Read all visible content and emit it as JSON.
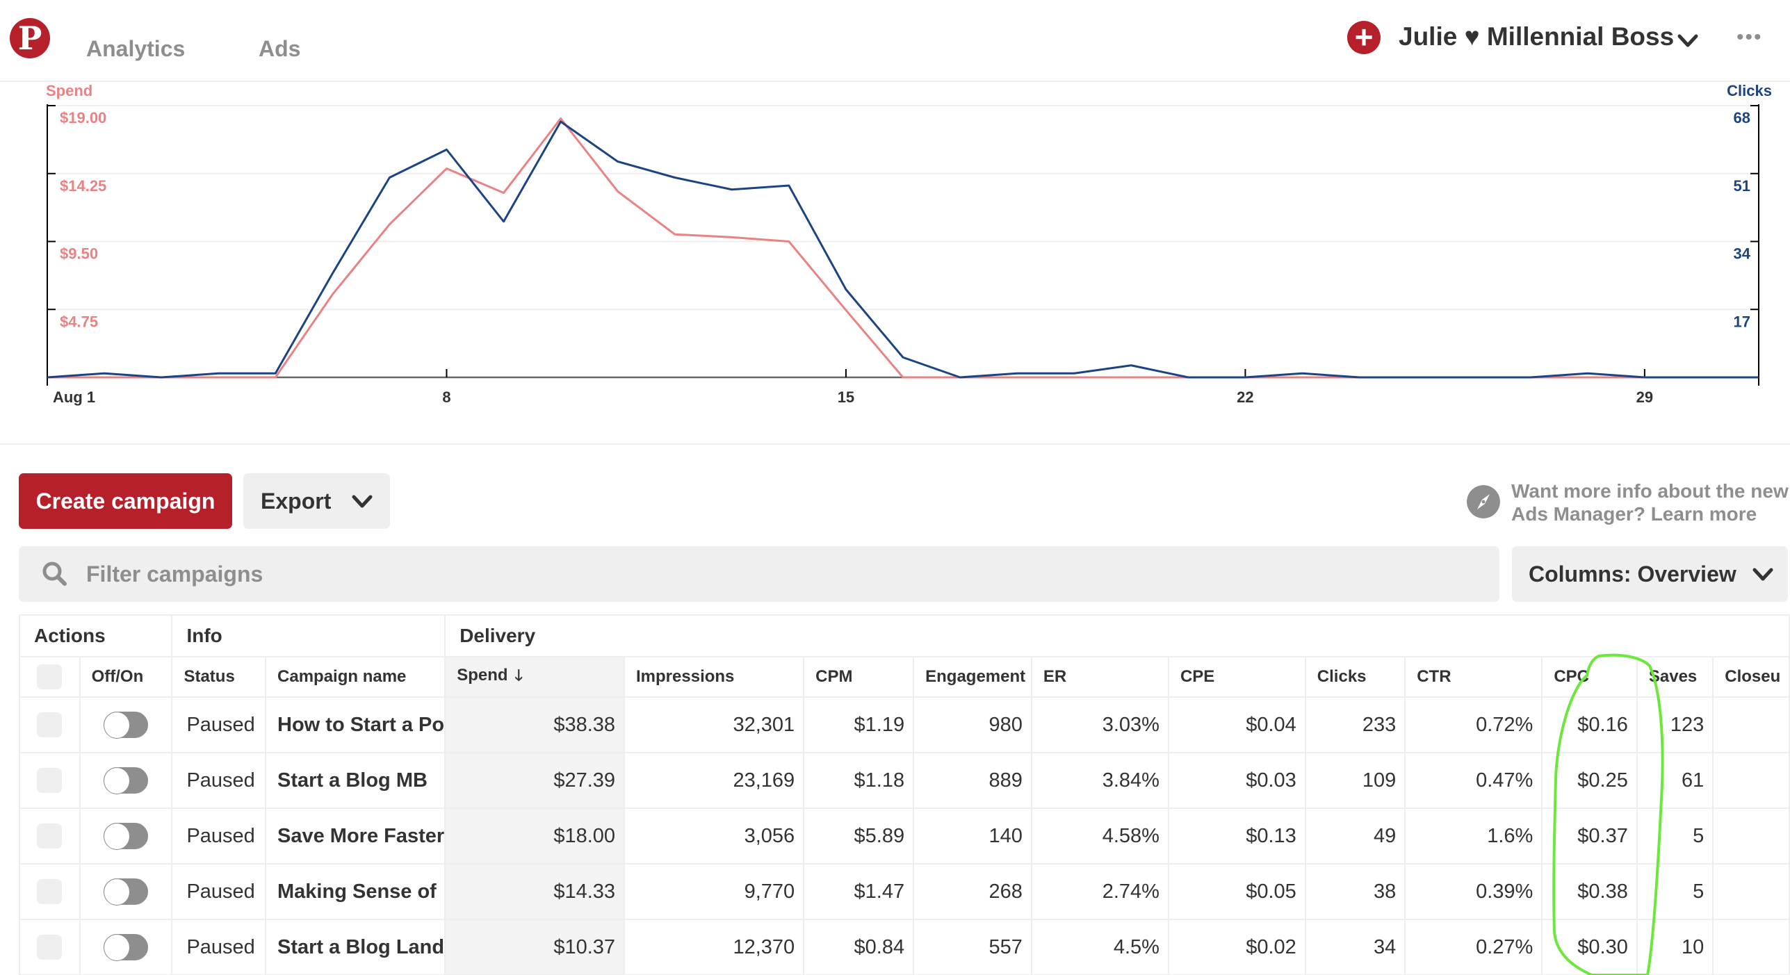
{
  "header": {
    "logo_glyph": "P",
    "nav": [
      {
        "label": "Analytics"
      },
      {
        "label": "Ads"
      }
    ],
    "add_glyph": "+",
    "account_name": "Julie ♥ Millennial Boss",
    "more_glyph": "•••"
  },
  "colors": {
    "brand_red": "#b5202a",
    "spend_line": "#e98283",
    "clicks_line": "#1c4483",
    "highlight_green": "#6ee73c"
  },
  "chart_data": {
    "type": "line",
    "title": "",
    "xlabel": "",
    "x": [
      1,
      2,
      3,
      4,
      5,
      6,
      7,
      8,
      9,
      10,
      11,
      12,
      13,
      14,
      15,
      16,
      17,
      18,
      19,
      20,
      21,
      22,
      23,
      24,
      25,
      26,
      27,
      28,
      29,
      30,
      31
    ],
    "x_tick_labels": [
      {
        "day": 1,
        "label": "Aug 1"
      },
      {
        "day": 8,
        "label": "8"
      },
      {
        "day": 15,
        "label": "15"
      },
      {
        "day": 22,
        "label": "22"
      },
      {
        "day": 29,
        "label": "29"
      }
    ],
    "y_left": {
      "label": "Spend",
      "range": [
        0,
        19
      ],
      "ticks": [
        {
          "value": 19,
          "label": "$19.00"
        },
        {
          "value": 14.25,
          "label": "$14.25"
        },
        {
          "value": 9.5,
          "label": "$9.50"
        },
        {
          "value": 4.75,
          "label": "$4.75"
        }
      ]
    },
    "y_right": {
      "label": "Clicks",
      "range": [
        0,
        68
      ],
      "ticks": [
        {
          "value": 68,
          "label": "68"
        },
        {
          "value": 51,
          "label": "51"
        },
        {
          "value": 34,
          "label": "34"
        },
        {
          "value": 17,
          "label": "17"
        }
      ]
    },
    "grid": true,
    "series": [
      {
        "name": "Spend",
        "axis": "left",
        "color": "#e98283",
        "values": [
          0,
          0,
          0,
          0,
          0,
          5.8,
          10.7,
          14.6,
          12.9,
          18.1,
          13.0,
          10.0,
          9.8,
          9.5,
          4.7,
          0,
          0,
          0,
          0,
          0,
          0,
          0,
          0,
          0,
          0,
          0,
          0,
          0,
          0,
          0,
          0
        ]
      },
      {
        "name": "Clicks",
        "axis": "right",
        "color": "#1c4483",
        "values": [
          0,
          1,
          0,
          1,
          1,
          26,
          50,
          57,
          39,
          64,
          54,
          50,
          47,
          48,
          22,
          5,
          0,
          1,
          1,
          3,
          0,
          0,
          1,
          0,
          0,
          0,
          0,
          1,
          0,
          0,
          0
        ]
      }
    ]
  },
  "toolbar": {
    "create_label": "Create campaign",
    "export_label": "Export",
    "info_line1": "Want more info about the new",
    "info_line2": "Ads Manager? Learn more",
    "search_placeholder": "Filter campaigns",
    "columns_label": "Columns: Overview"
  },
  "table": {
    "groups": [
      "Actions",
      "Info",
      "Delivery"
    ],
    "headers": [
      "",
      "Off/On",
      "Status",
      "Campaign name",
      "Spend",
      "Impressions",
      "CPM",
      "Engagement",
      "ER",
      "CPE",
      "Clicks",
      "CTR",
      "CPC",
      "Saves",
      "Closeu"
    ],
    "sort_glyph": "🡓",
    "rows": [
      {
        "status": "Paused",
        "name": "How to Start a Po",
        "spend": "$38.38",
        "impressions": "32,301",
        "cpm": "$1.19",
        "engagement": "980",
        "er": "3.03%",
        "cpe": "$0.04",
        "clicks": "233",
        "ctr": "0.72%",
        "cpc": "$0.16",
        "saves": "123",
        "closeups": ""
      },
      {
        "status": "Paused",
        "name": "Start a Blog MB",
        "spend": "$27.39",
        "impressions": "23,169",
        "cpm": "$1.18",
        "engagement": "889",
        "er": "3.84%",
        "cpe": "$0.03",
        "clicks": "109",
        "ctr": "0.47%",
        "cpc": "$0.25",
        "saves": "61",
        "closeups": ""
      },
      {
        "status": "Paused",
        "name": "Save More Faster",
        "spend": "$18.00",
        "impressions": "3,056",
        "cpm": "$5.89",
        "engagement": "140",
        "er": "4.58%",
        "cpe": "$0.13",
        "clicks": "49",
        "ctr": "1.6%",
        "cpc": "$0.37",
        "saves": "5",
        "closeups": ""
      },
      {
        "status": "Paused",
        "name": "Making Sense of",
        "spend": "$14.33",
        "impressions": "9,770",
        "cpm": "$1.47",
        "engagement": "268",
        "er": "2.74%",
        "cpe": "$0.05",
        "clicks": "38",
        "ctr": "0.39%",
        "cpc": "$0.38",
        "saves": "5",
        "closeups": ""
      },
      {
        "status": "Paused",
        "name": "Start a Blog Land",
        "spend": "$10.37",
        "impressions": "12,370",
        "cpm": "$0.84",
        "engagement": "557",
        "er": "4.5%",
        "cpe": "$0.02",
        "clicks": "34",
        "ctr": "0.27%",
        "cpc": "$0.30",
        "saves": "10",
        "closeups": ""
      }
    ]
  }
}
